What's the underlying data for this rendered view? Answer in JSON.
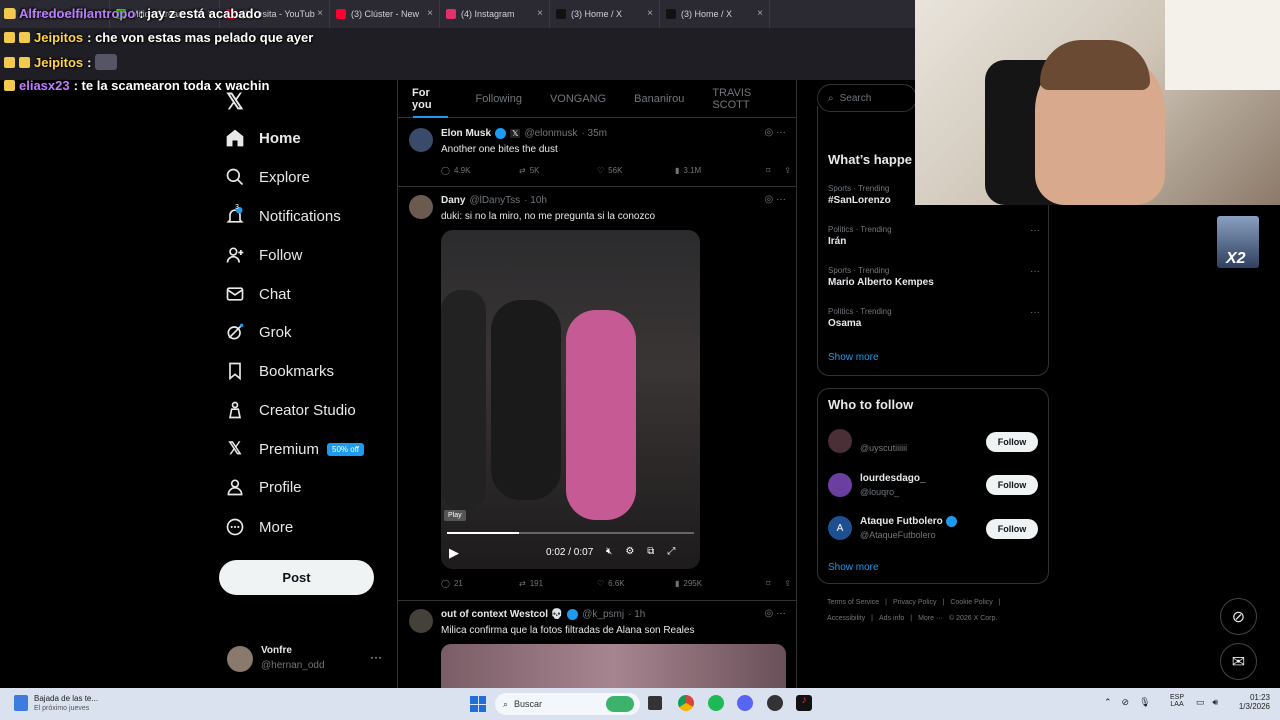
{
  "browser_tabs": [
    {
      "label": "Alfredoelfilantropo",
      "color": "#c07cff"
    },
    {
      "label": "Milica Stream - W",
      "color": "#53fc18"
    },
    {
      "label": "(3) rosita - YouTub",
      "color": "#ff0033"
    },
    {
      "label": "(3) Clúster - New",
      "color": "#ff0033"
    },
    {
      "label": "(4) Instagram",
      "color": "#e1306c"
    },
    {
      "label": "(3) Home / X",
      "color": "#111"
    },
    {
      "label": "(3) Home / X",
      "color": "#111"
    }
  ],
  "chat": [
    {
      "user": "Alfredoelfilantropo",
      "msg": ": jay z está acabado"
    },
    {
      "user": "Jeipitos",
      "msg": ": che von estas mas pelado que ayer"
    },
    {
      "user": "Jeipitos",
      "msg": ":"
    },
    {
      "user": "eliasx23",
      "msg": ": te la scamearon toda x wachin"
    }
  ],
  "nav": {
    "home": "Home",
    "explore": "Explore",
    "notifications": "Notifications",
    "notif_count": "3",
    "follow": "Follow",
    "chat": "Chat",
    "grok": "Grok",
    "bookmarks": "Bookmarks",
    "creator": "Creator Studio",
    "premium": "Premium",
    "premium_badge": "50% off",
    "profile": "Profile",
    "more": "More",
    "post": "Post"
  },
  "account": {
    "name": "Vonfre",
    "handle": "@hernan_odd"
  },
  "feed_tabs": [
    "For you",
    "Following",
    "VONGANG",
    "Bananirou",
    "TRAVIS SCOTT"
  ],
  "tweets": [
    {
      "name": "Elon Musk",
      "handle": "@elonmusk",
      "time": "· 35m",
      "text": "Another one bites the dust",
      "replies": "4.9K",
      "reposts": "5K",
      "likes": "56K",
      "views": "3.1M"
    },
    {
      "name": "Dany",
      "handle": "@lDanyTss",
      "time": "· 10h",
      "text": "duki: si no la miro, no me pregunta si la conozco",
      "replies": "21",
      "reposts": "191",
      "likes": "6.6K",
      "views": "295K",
      "video_time": "0:02 / 0:07",
      "video_tooltip": "Play",
      "video_progress": 0.29
    },
    {
      "name": "out of context Westcol 💀",
      "handle": "@k_psmj",
      "time": "· 1h",
      "text": "Milica confirma que la fotos filtradas de Alana son Reales"
    }
  ],
  "search": {
    "placeholder": "Search"
  },
  "happening": {
    "title": "What’s happe",
    "trends": [
      {
        "cat": "Sports · Trending",
        "name": "#SanLorenzo"
      },
      {
        "cat": "Politics · Trending",
        "name": "Irán"
      },
      {
        "cat": "Sports · Trending",
        "name": "Mario Alberto Kempes"
      },
      {
        "cat": "Politics · Trending",
        "name": "Osama"
      }
    ],
    "show_more": "Show more"
  },
  "who_to_follow": {
    "title": "Who to follow",
    "users": [
      {
        "name": "",
        "handle": "@uyscutiiiiii"
      },
      {
        "name": "lourdesdago_",
        "handle": "@louqro_"
      },
      {
        "name": "Ataque Futbolero",
        "handle": "@AtaqueFutbolero"
      }
    ],
    "follow_label": "Follow",
    "show_more": "Show more"
  },
  "footer": {
    "line1": [
      "Terms of Service",
      "Privacy Policy",
      "Cookie Policy"
    ],
    "line2": [
      "Accessibility",
      "Ads info",
      "More ···",
      "© 2026 X Corp."
    ]
  },
  "overlay": {
    "x2": "X2"
  },
  "taskbar": {
    "weather_title": "Bajada de las te...",
    "weather_sub": "El próximo jueves",
    "search": "Buscar",
    "lang1": "ESP",
    "lang2": "LAA",
    "time": "01:23",
    "date": "1/3/2026"
  }
}
